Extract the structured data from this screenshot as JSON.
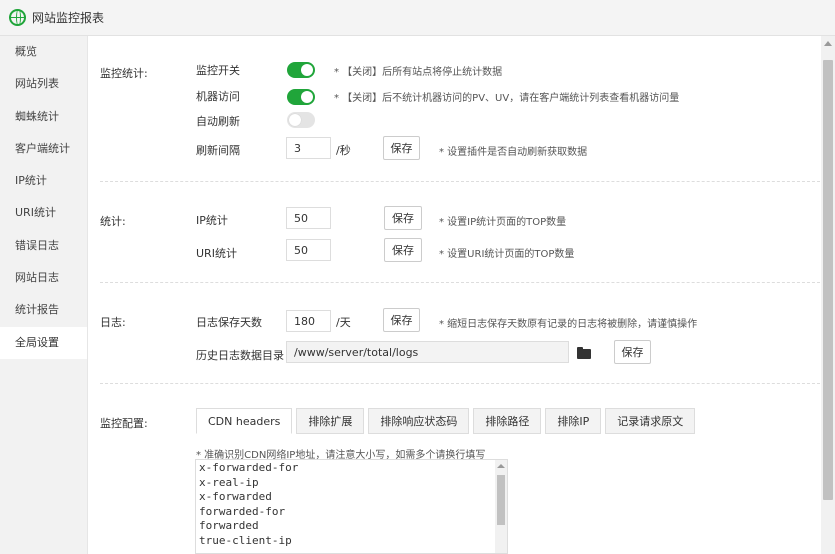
{
  "window": {
    "title": "网站监控报表"
  },
  "sidebar": {
    "items": [
      {
        "label": "概览"
      },
      {
        "label": "网站列表"
      },
      {
        "label": "蜘蛛统计"
      },
      {
        "label": "客户端统计"
      },
      {
        "label": "IP统计"
      },
      {
        "label": "URI统计"
      },
      {
        "label": "错误日志"
      },
      {
        "label": "网站日志"
      },
      {
        "label": "统计报告"
      },
      {
        "label": "全局设置"
      }
    ],
    "active_index": 9
  },
  "monitor": {
    "section_label": "监控统计:",
    "switch_label": "监控开关",
    "switch_on": true,
    "switch_hint": "* 【关闭】后所有站点将停止统计数据",
    "robot_label": "机器访问",
    "robot_on": true,
    "robot_hint": "* 【关闭】后不统计机器访问的PV、UV，请在客户端统计列表查看机器访问量",
    "autorefresh_label": "自动刷新",
    "autorefresh_on": false,
    "interval_label": "刷新间隔",
    "interval_value": "3",
    "interval_unit": "/秒",
    "interval_save": "保存",
    "interval_hint": "* 设置插件是否自动刷新获取数据"
  },
  "stats": {
    "section_label": "统计:",
    "ip_label": "IP统计",
    "ip_value": "50",
    "ip_save": "保存",
    "ip_hint": "* 设置IP统计页面的TOP数量",
    "uri_label": "URI统计",
    "uri_value": "50",
    "uri_save": "保存",
    "uri_hint": "* 设置URI统计页面的TOP数量"
  },
  "logs": {
    "section_label": "日志:",
    "days_label": "日志保存天数",
    "days_value": "180",
    "days_unit": "/天",
    "days_save": "保存",
    "days_hint": "* 缩短日志保存天数原有记录的日志将被删除，请谨慎操作",
    "dir_label": "历史日志数据目录",
    "dir_value": "/www/server/total/logs",
    "dir_save": "保存"
  },
  "config": {
    "section_label": "监控配置:",
    "tabs": [
      "CDN headers",
      "排除扩展",
      "排除响应状态码",
      "排除路径",
      "排除IP",
      "记录请求原文"
    ],
    "active_tab": 0,
    "hint": "* 准确识别CDN网络IP地址，请注意大小写，如需多个请换行填写",
    "headers": [
      "x-forwarded-for",
      "x-real-ip",
      "x-forwarded",
      "forwarded-for",
      "forwarded",
      "true-client-ip"
    ]
  }
}
